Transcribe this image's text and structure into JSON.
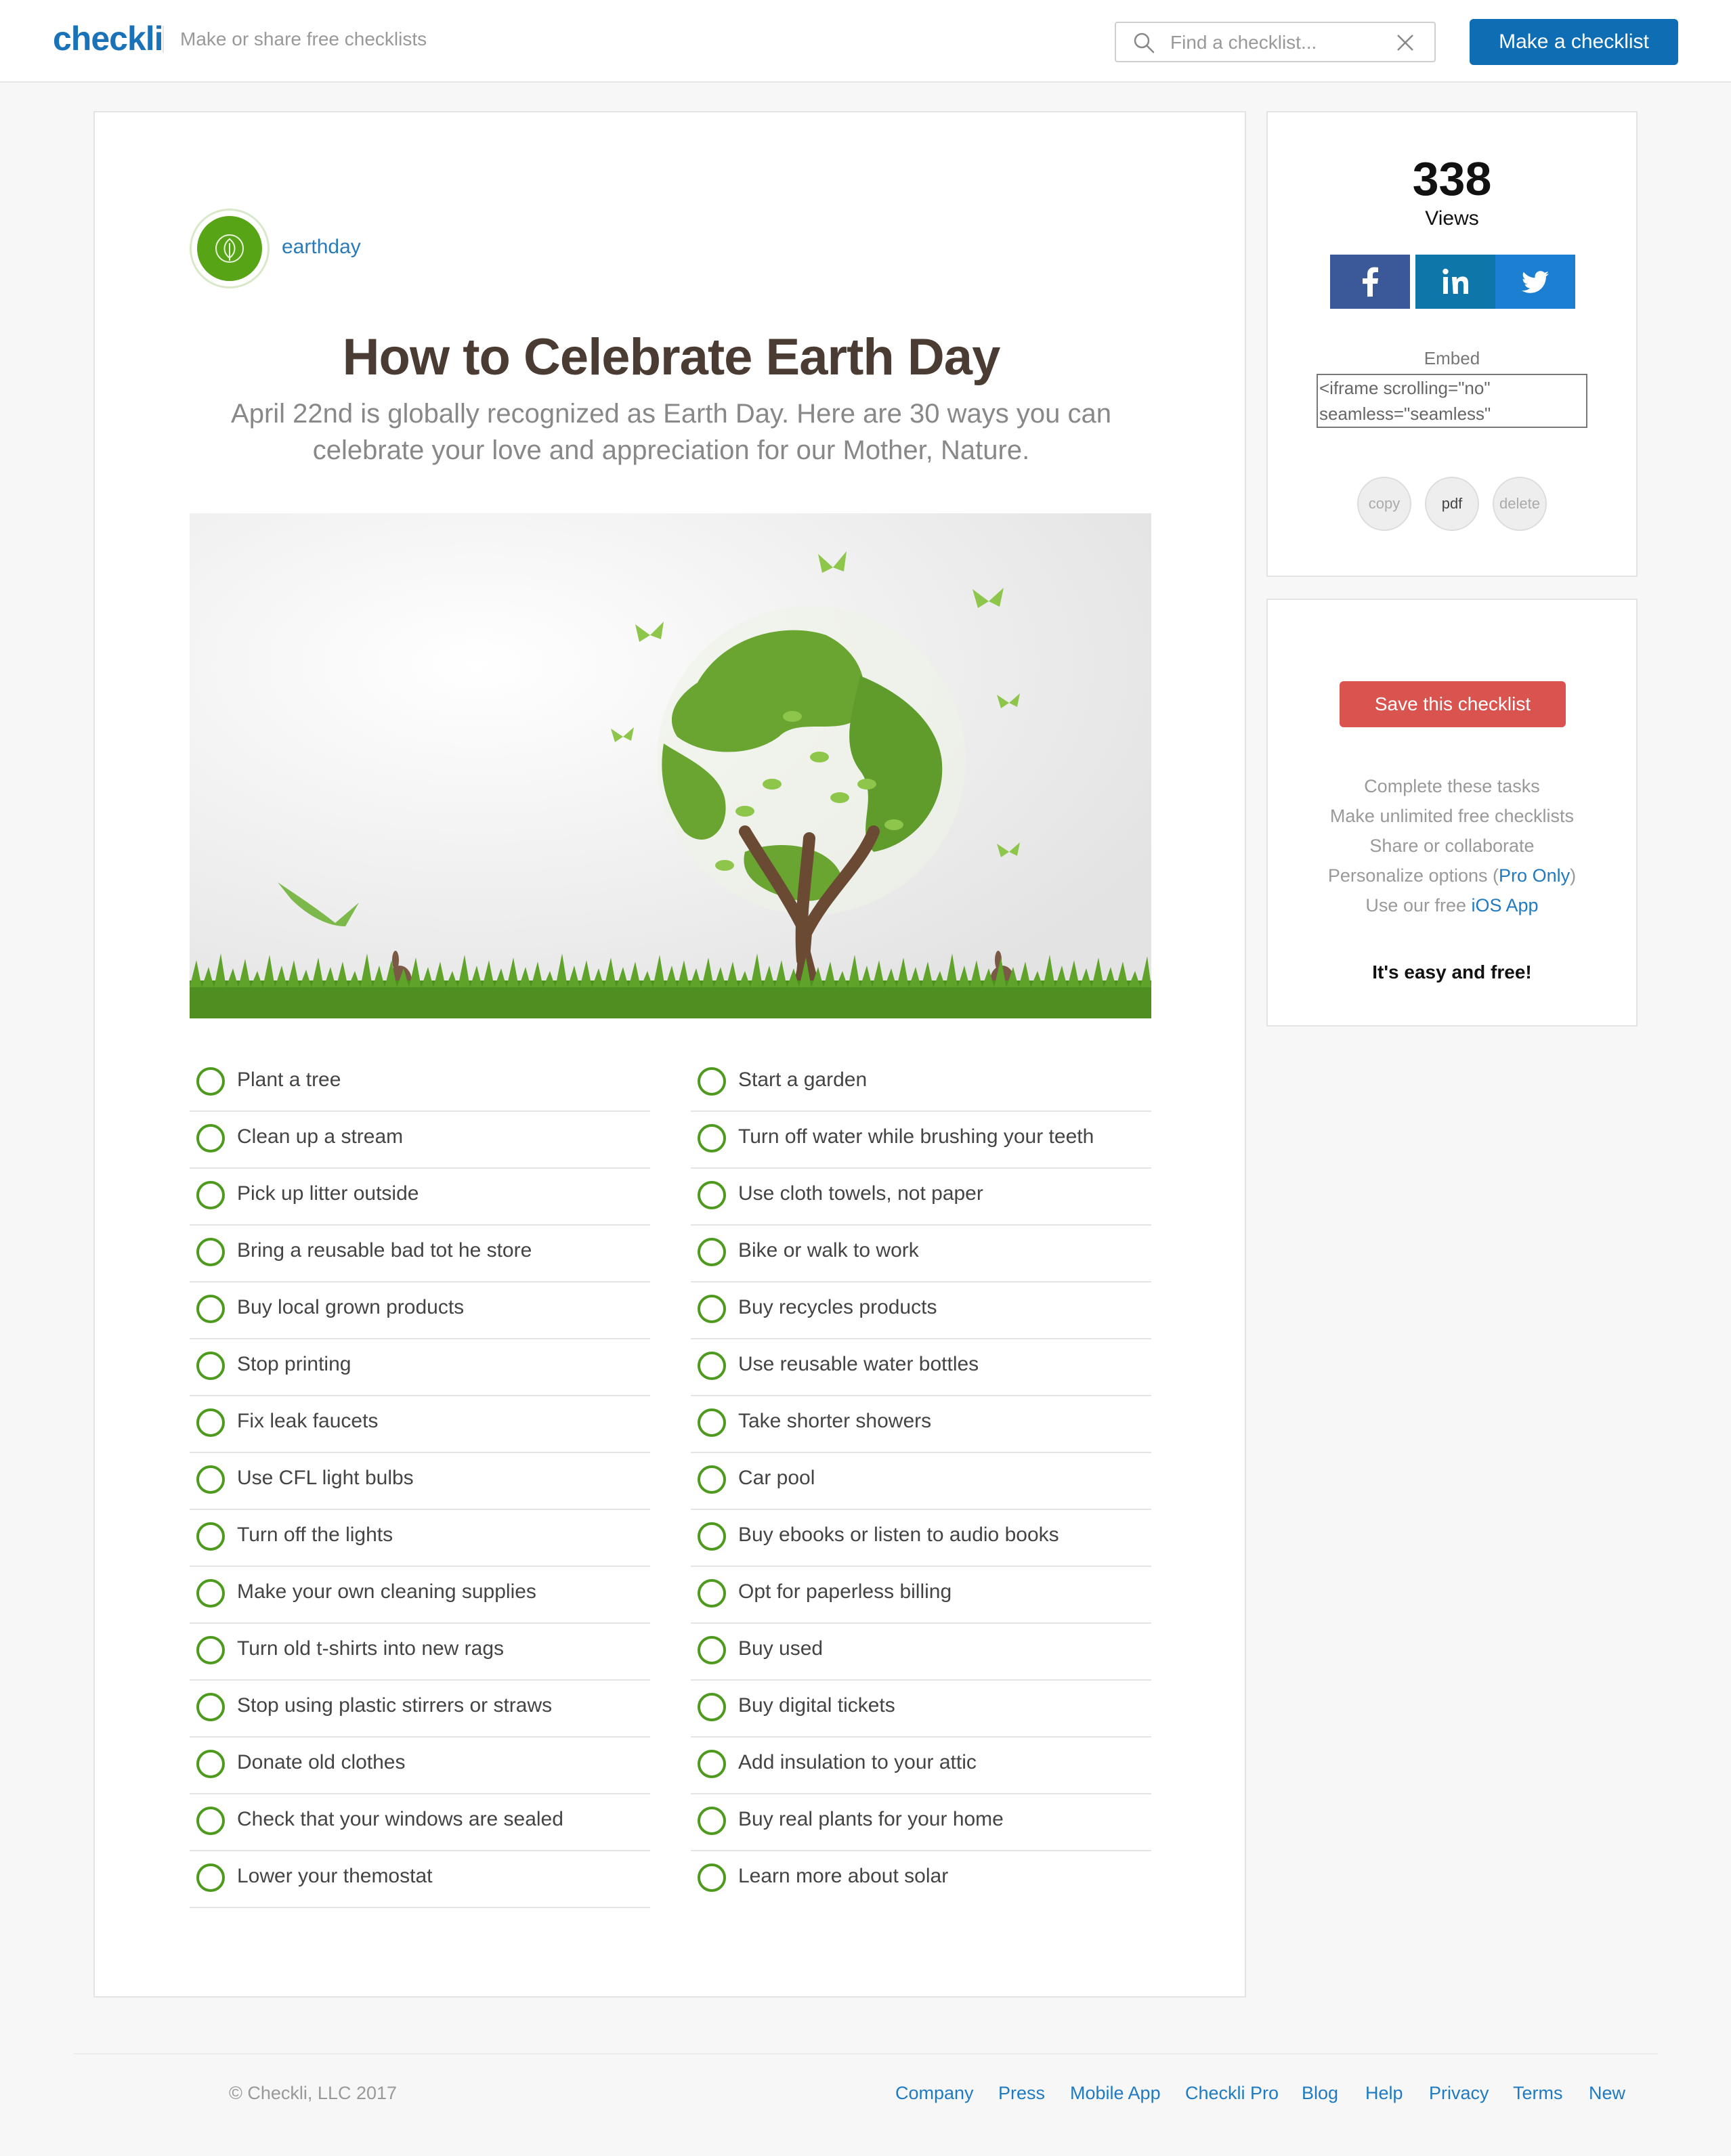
{
  "header": {
    "logo": "checkli",
    "tagline": "Make or share free checklists",
    "search_placeholder": "Find a checklist...",
    "make_button": "Make a checklist"
  },
  "checklist": {
    "author": "earthday",
    "title": "How to Celebrate Earth Day",
    "description_line1": "April 22nd is globally recognized as Earth Day. Here are 30 ways you can",
    "description_line2": "celebrate your love and appreciation for our Mother, Nature.",
    "left_items": [
      "Plant a tree",
      "Clean up a stream",
      "Pick up litter outside",
      "Bring a reusable bad tot he store",
      "Buy local grown products",
      "Stop printing",
      "Fix leak faucets",
      "Use CFL light bulbs",
      "Turn off the lights",
      "Make your own cleaning supplies",
      "Turn old t-shirts into new rags",
      "Stop using plastic stirrers or straws",
      "Donate old clothes",
      "Check that your windows are sealed",
      "Lower your themostat"
    ],
    "right_items": [
      "Start a garden",
      "Turn off water while brushing your teeth",
      "Use cloth towels, not paper",
      "Bike or walk to work",
      "Buy recycles products",
      "Use reusable water bottles",
      "Take shorter showers",
      "Car pool",
      "Buy ebooks or listen to audio books",
      "Opt for paperless billing",
      "Buy used",
      "Buy digital tickets",
      "Add insulation to your attic",
      "Buy real plants for your home",
      "Learn more about solar"
    ]
  },
  "sidebar": {
    "views_count": "338",
    "views_label": "Views",
    "embed_label": "Embed",
    "embed_code": "<iframe scrolling=\"no\" seamless=\"seamless\"",
    "copy": "copy",
    "pdf": "pdf",
    "delete": "delete",
    "save_button": "Save this checklist",
    "feature1": "Complete these tasks",
    "feature2": "Make unlimited free checklists",
    "feature3": "Share or collaborate",
    "feature4_prefix": "Personalize options (",
    "feature4_link": "Pro Only",
    "feature4_suffix": ")",
    "feature5_prefix": "Use our free ",
    "feature5_link": "iOS App",
    "tagline": "It's easy and free!"
  },
  "footer": {
    "copyright": "© Checkli, LLC 2017",
    "links": [
      "Company",
      "Press",
      "Mobile App",
      "Checkli Pro",
      "Blog",
      "Help",
      "Privacy",
      "Terms",
      "New"
    ]
  },
  "colors": {
    "brand_blue": "#0f6db3",
    "check_green": "#4e9a1e",
    "save_red": "#d9534f",
    "facebook": "#3b5998",
    "linkedin": "#0e76a8",
    "twitter": "#1d7fd1"
  }
}
